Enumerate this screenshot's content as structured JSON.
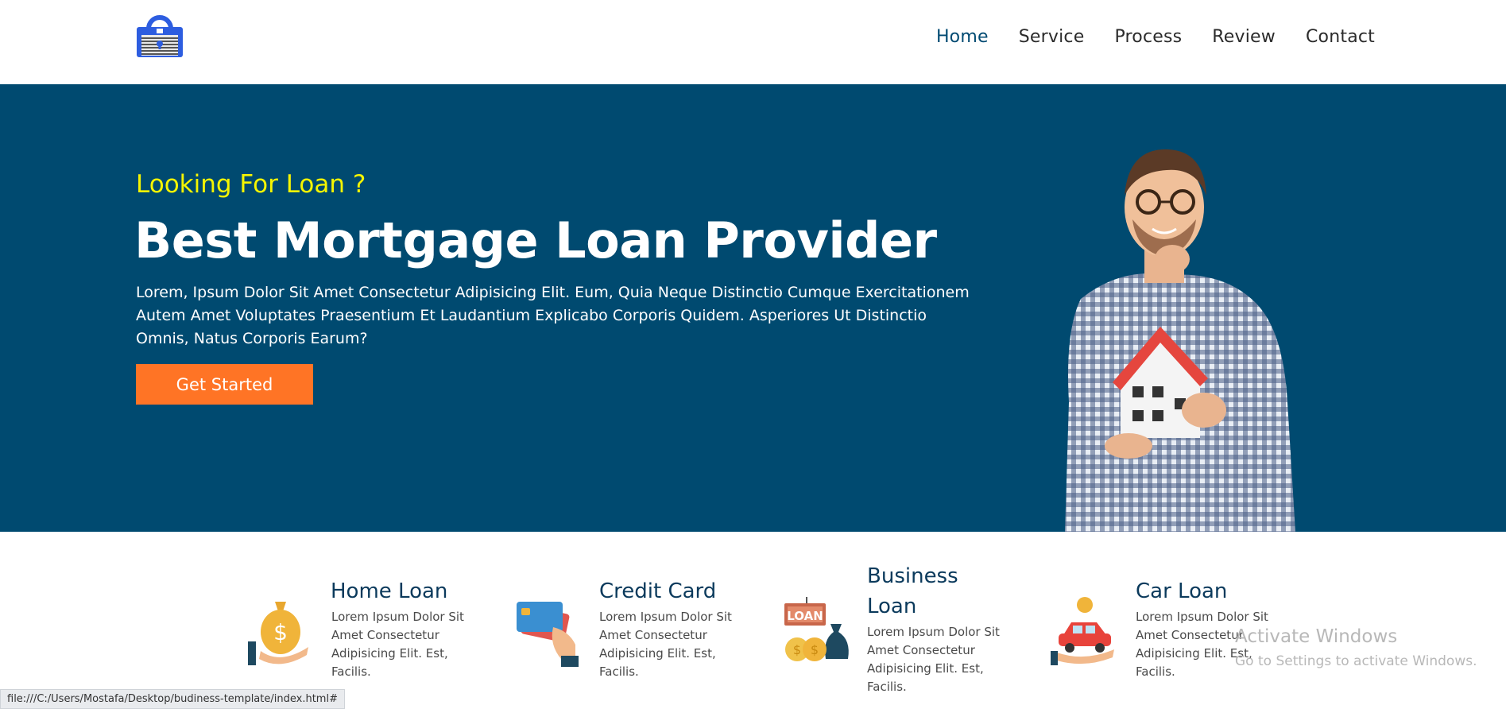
{
  "nav": {
    "items": [
      {
        "label": "Home",
        "active": true
      },
      {
        "label": "Service",
        "active": false
      },
      {
        "label": "Process",
        "active": false
      },
      {
        "label": "Review",
        "active": false
      },
      {
        "label": "Contact",
        "active": false
      }
    ]
  },
  "hero": {
    "subtitle": "Looking For Loan ?",
    "title": "Best Mortgage Loan Provider",
    "text": "Lorem, Ipsum Dolor Sit Amet Consectetur Adipisicing Elit. Eum, Quia Neque Distinctio Cumque Exercitationem Autem Amet Voluptates Praesentium Et Laudantium Explicabo Corporis Quidem. Asperiores Ut Distinctio Omnis, Natus Corporis Earum?",
    "button": "Get Started"
  },
  "services": [
    {
      "title": "Home Loan",
      "text": "Lorem Ipsum Dolor Sit Amet Consectetur Adipisicing Elit. Est, Facilis.",
      "icon": "money-bag-hand-icon"
    },
    {
      "title": "Credit Card",
      "text": "Lorem Ipsum Dolor Sit Amet Consectetur Adipisicing Elit. Est, Facilis.",
      "icon": "credit-card-icon"
    },
    {
      "title": "Business Loan",
      "title_line1": "Business",
      "title_line2": "Loan",
      "text": "Lorem Ipsum Dolor Sit Amet Consectetur Adipisicing Elit. Est, Facilis.",
      "icon": "loan-sign-icon",
      "icon_text": "LOAN"
    },
    {
      "title": "Car Loan",
      "text": "Lorem Ipsum Dolor Sit Amet Consectetur Adipisicing Elit. Est, Facilis.",
      "icon": "car-coin-hand-icon"
    }
  ],
  "statusbar": "file:///C:/Users/Mostafa/Desktop/budiness-template/index.html#",
  "watermark": {
    "line1": "Activate Windows",
    "line2": "Go to Settings to activate Windows."
  },
  "colors": {
    "hero_bg": "#004a70",
    "accent_yellow": "#f5f500",
    "button_orange": "#ff7425",
    "nav_active": "#004a72",
    "service_title": "#0b3a5c"
  }
}
